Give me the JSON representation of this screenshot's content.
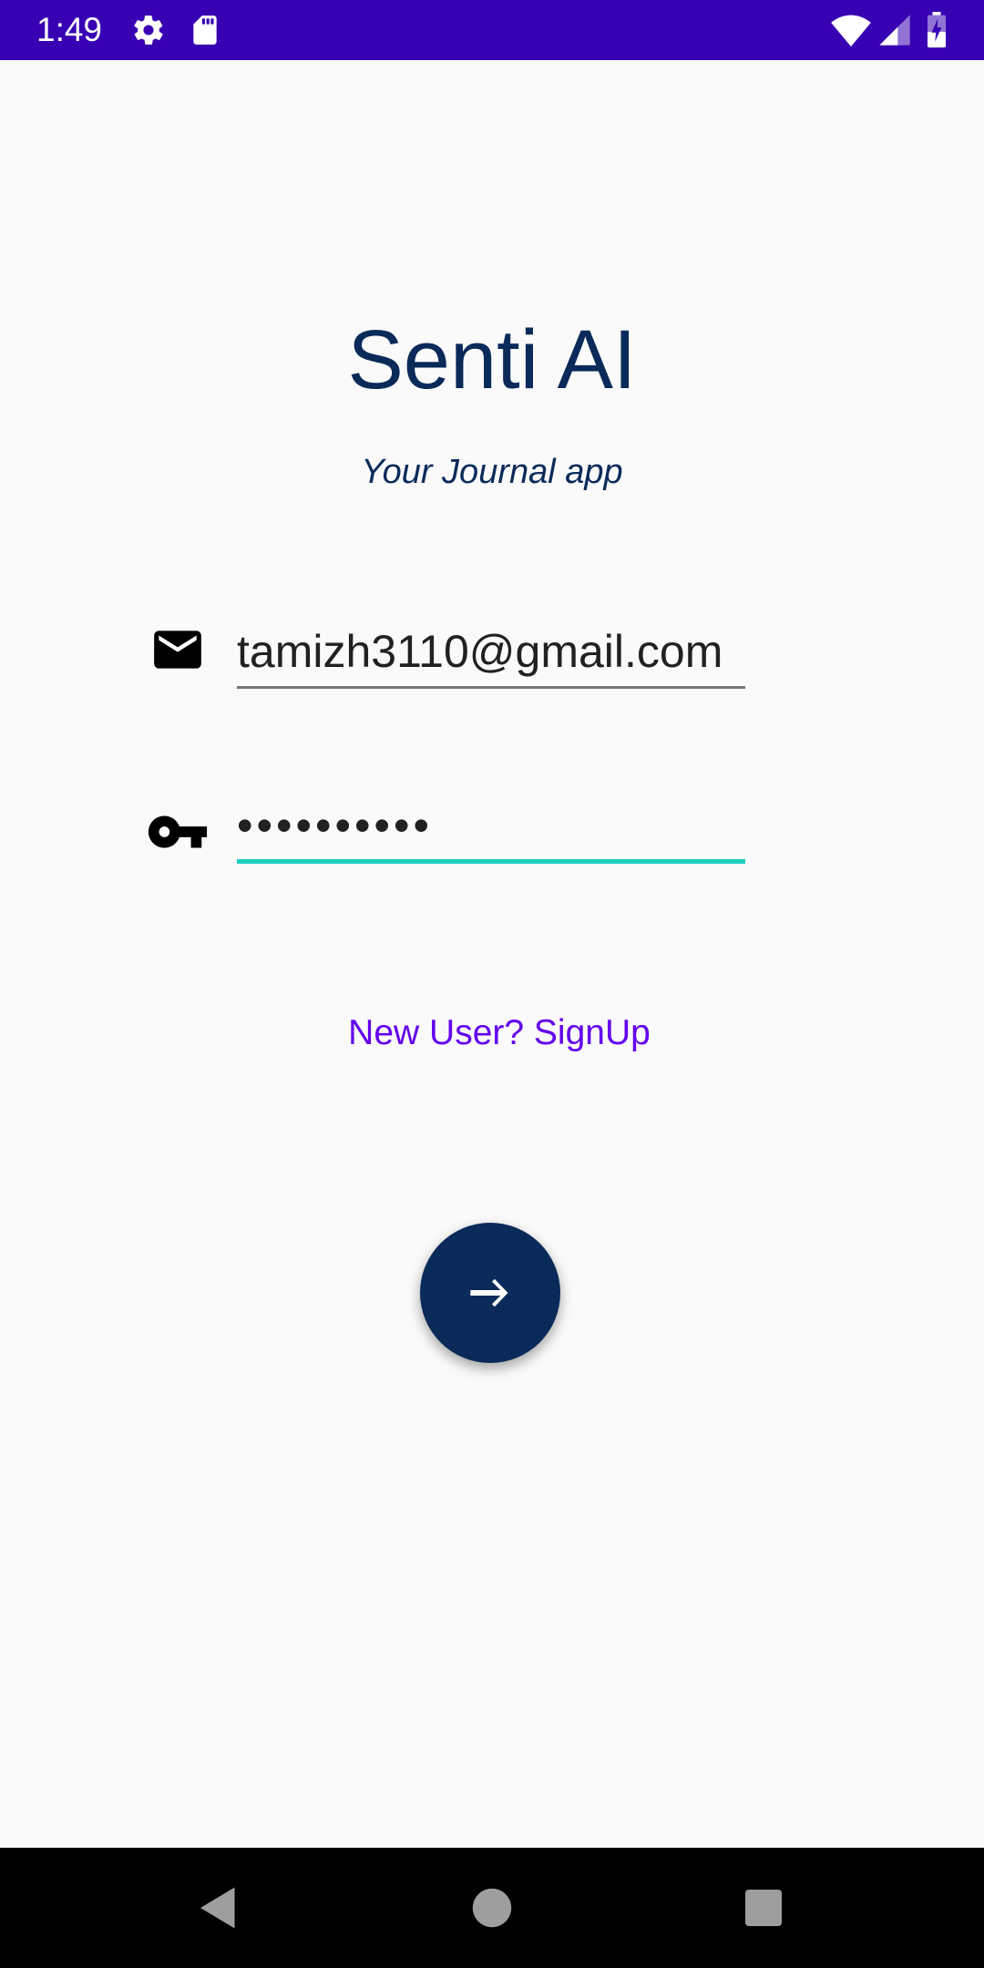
{
  "status_bar": {
    "time": "1:49",
    "background": "#3700b3",
    "icons": [
      "settings-icon",
      "sd-card-icon",
      "wifi-icon",
      "signal-icon",
      "battery-charging-icon"
    ]
  },
  "app": {
    "title": "Senti AI",
    "subtitle": "Your Journal app",
    "title_color": "#0a2a5a"
  },
  "form": {
    "email": {
      "icon": "mail-icon",
      "value": "tamizh3110@gmail.com"
    },
    "password": {
      "icon": "key-icon",
      "value": "••••••••••",
      "underline_color": "#1ccfc0"
    },
    "signup_link": "New User? SignUp",
    "signup_color": "#6200ee",
    "submit_icon": "arrow-right-icon"
  },
  "nav_bar": {
    "buttons": [
      "back-icon",
      "home-icon",
      "recents-icon"
    ]
  }
}
